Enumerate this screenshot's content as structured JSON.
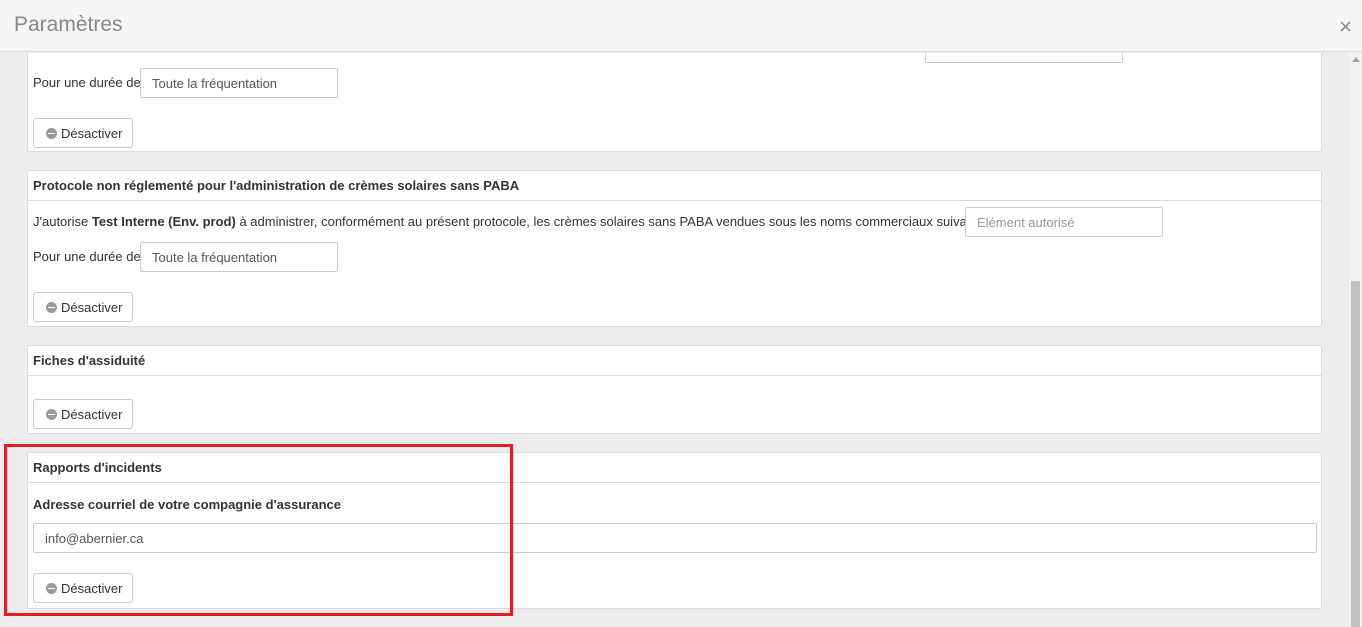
{
  "modal": {
    "title": "Paramètres",
    "close_symbol": "×"
  },
  "panels": [
    {
      "duration_label": "Pour une durée de",
      "duration_value": "Toute la fréquentation",
      "deactivate_label": "Désactiver"
    },
    {
      "title": "Protocole non réglementé pour l'administration de crèmes solaires sans PABA",
      "auth_text_prefix": "J'autorise ",
      "auth_entity": "Test Interne (Env. prod)",
      "auth_text_suffix": " à administrer, conformément au présent protocole, les crèmes solaires sans PABA vendues sous les noms commerciaux suivants :",
      "authorized_placeholder": "Elément autorisé",
      "duration_label": "Pour une durée de",
      "duration_value": "Toute la fréquentation",
      "deactivate_label": "Désactiver"
    },
    {
      "title": "Fiches d'assiduité",
      "deactivate_label": "Désactiver"
    },
    {
      "title": "Rapports d'incidents",
      "email_label": "Adresse courriel de votre compagnie d'assurance",
      "email_value": "info@abernier.ca",
      "deactivate_label": "Désactiver"
    }
  ],
  "colors": {
    "highlight": "#e21d26",
    "background": "#ececec"
  }
}
